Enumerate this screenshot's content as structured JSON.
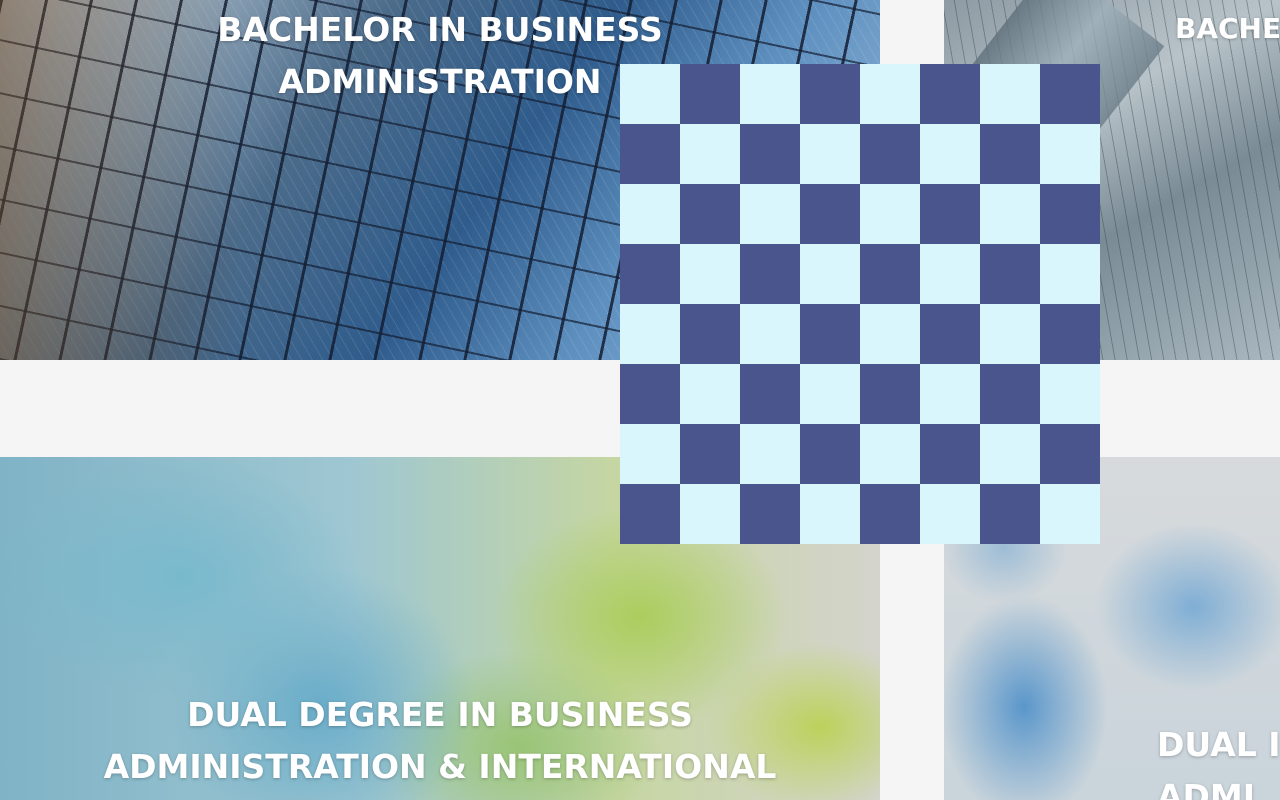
{
  "cards": [
    {
      "title_lines": [
        "BACHELOR IN BUSINESS",
        "ADMINISTRATION"
      ]
    },
    {
      "title_lines": [
        "BACHE"
      ]
    },
    {
      "title_lines": [
        "DUAL DEGREE IN BUSINESS",
        "ADMINISTRATION & INTERNATIONAL"
      ]
    },
    {
      "title_lines": [
        "DUAL I",
        "ADMI"
      ]
    }
  ],
  "checkerboard": {
    "rows": 8,
    "cols": 8,
    "colors": {
      "dark": "#4a558e",
      "light": "#d9f6fd"
    }
  },
  "colors": {
    "page_background": "#f5f5f5",
    "title_text": "#ffffff"
  }
}
